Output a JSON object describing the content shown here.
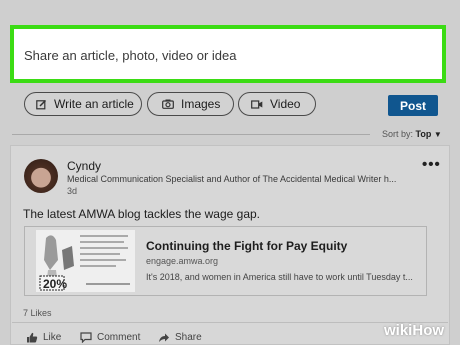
{
  "composer": {
    "placeholder": "Share an article, photo, video or idea"
  },
  "actions": {
    "write_article": "Write an article",
    "images": "Images",
    "video": "Video",
    "post": "Post"
  },
  "sort": {
    "label": "Sort by:",
    "value": "Top"
  },
  "post": {
    "author": "Cyndy",
    "author_title": "Medical Communication Specialist and Author of The Accidental Medical Writer h...",
    "time": "3d",
    "text": "The latest AMWA blog tackles the wage gap.",
    "link": {
      "title": "Continuing the Fight for Pay Equity",
      "url": "engage.amwa.org",
      "description": "It's 2018, and women in America still have to work until Tuesday t..."
    },
    "likes": "7 Likes",
    "buttons": {
      "like": "Like",
      "comment": "Comment",
      "share": "Share"
    }
  },
  "watermark": {
    "wiki": "wiki",
    "how": "How"
  },
  "colors": {
    "highlight": "#3bdc14",
    "post_button": "#10568f"
  },
  "icons": [
    "edit-icon",
    "camera-icon",
    "video-camera-icon",
    "more-icon",
    "thumbs-up-icon",
    "comment-icon",
    "share-icon"
  ]
}
